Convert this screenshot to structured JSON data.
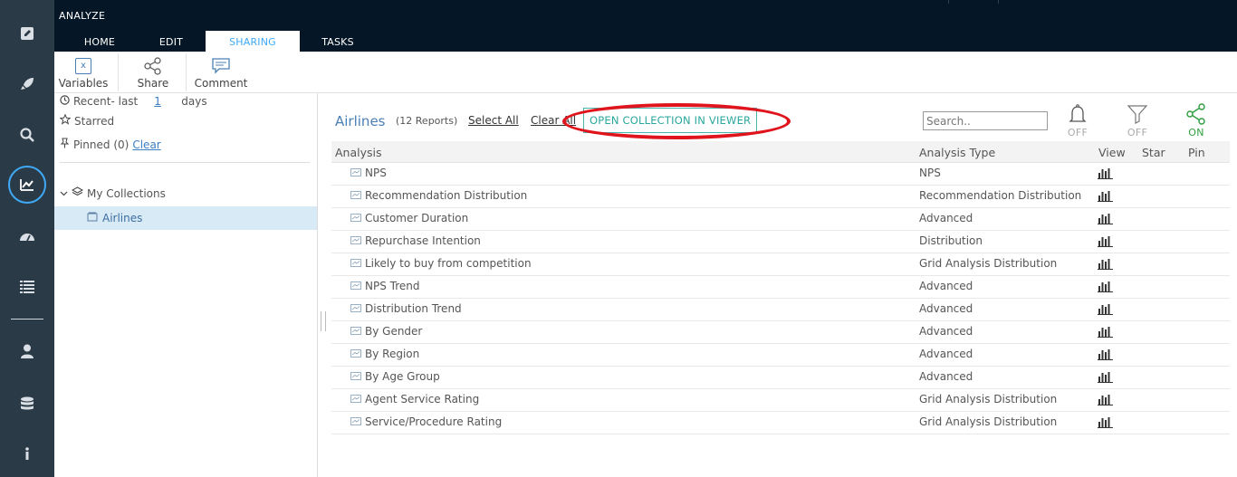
{
  "app": {
    "title": "ANALYZE"
  },
  "tabs": [
    {
      "label": "HOME",
      "active": false
    },
    {
      "label": "EDIT",
      "active": false
    },
    {
      "label": "SHARING",
      "active": true
    },
    {
      "label": "TASKS",
      "active": false
    }
  ],
  "ribbon": {
    "variables_label": "Variables",
    "variables_icon_text": "x",
    "share_label": "Share",
    "comment_label": "Comment"
  },
  "rail_icons": [
    "pencil-icon",
    "rocket-icon",
    "search-icon",
    "trend-chart-icon",
    "dashboard-icon",
    "list-icon",
    "user-icon",
    "database-icon",
    "info-icon"
  ],
  "left_panel": {
    "recent_prefix": "Recent- last",
    "recent_days_value": "1",
    "recent_suffix": "days",
    "starred_label": "Starred",
    "pinned_label": "Pinned (0)",
    "clear_label": "Clear",
    "my_collections_label": "My Collections",
    "selected_collection": "Airlines"
  },
  "main": {
    "collection_title": "Airlines",
    "report_count": "(12 Reports)",
    "select_all_label": "Select All",
    "clear_all_label": "Clear All",
    "open_collection_label": "OPEN COLLECTION IN VIEWER",
    "search_placeholder": "Search..",
    "toggles": {
      "notify_state": "OFF",
      "filter_state": "OFF",
      "share_state": "ON"
    },
    "colors": {
      "accent_blue": "#3fa9f5",
      "teal": "#2aa79d",
      "share_on_green": "#2e9e3e",
      "annotation_red": "#e0141c"
    }
  },
  "table": {
    "headers": {
      "analysis": "Analysis",
      "type": "Analysis Type",
      "view": "View",
      "star": "Star",
      "pin": "Pin"
    },
    "rows": [
      {
        "name": "NPS",
        "type": "NPS"
      },
      {
        "name": "Recommendation Distribution",
        "type": "Recommendation Distribution"
      },
      {
        "name": "Customer Duration",
        "type": "Advanced"
      },
      {
        "name": "Repurchase Intention",
        "type": "Distribution"
      },
      {
        "name": "Likely to buy from competition",
        "type": "Grid Analysis Distribution"
      },
      {
        "name": "NPS Trend",
        "type": "Advanced"
      },
      {
        "name": "Distribution Trend",
        "type": "Advanced"
      },
      {
        "name": "By Gender",
        "type": "Advanced"
      },
      {
        "name": "By Region",
        "type": "Advanced"
      },
      {
        "name": "By Age Group",
        "type": "Advanced"
      },
      {
        "name": "Agent Service Rating",
        "type": "Grid Analysis Distribution"
      },
      {
        "name": "Service/Procedure Rating",
        "type": "Grid Analysis Distribution"
      }
    ]
  }
}
